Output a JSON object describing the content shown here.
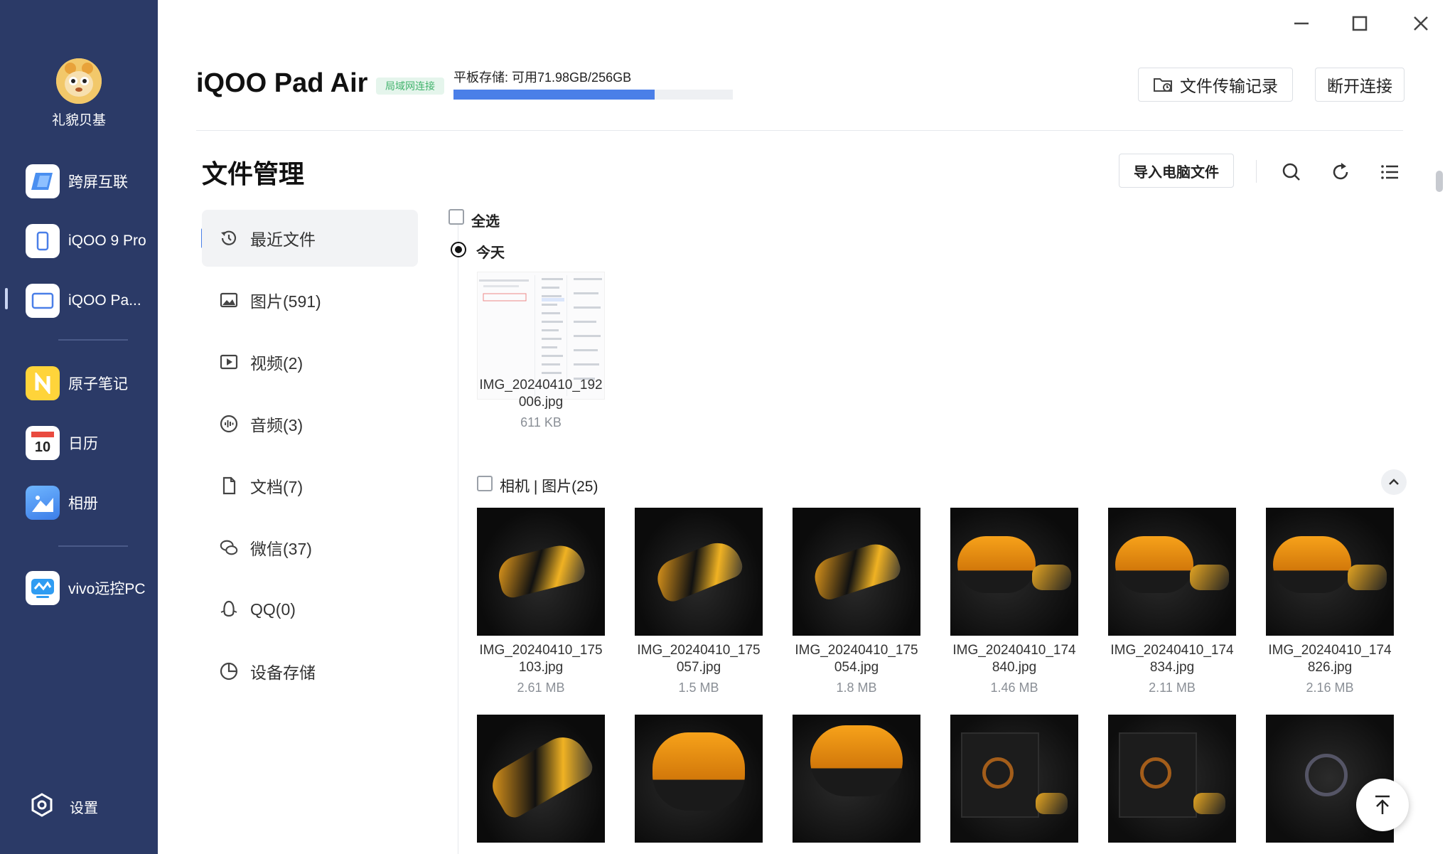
{
  "sidebar": {
    "user_name": "礼貌贝基",
    "items": [
      {
        "label": "跨屏互联"
      },
      {
        "label": "iQOO 9 Pro"
      },
      {
        "label": "iQOO Pa..."
      },
      {
        "label": "原子笔记"
      },
      {
        "label": "日历",
        "calendar_day": "10"
      },
      {
        "label": "相册"
      },
      {
        "label": "vivo远控PC"
      }
    ],
    "settings_label": "设置"
  },
  "window": {
    "minimize": "—",
    "maximize": "☐",
    "close": "✕"
  },
  "header": {
    "device_name": "iQOO Pad Air",
    "connection_tag": "局域网连接",
    "storage_text": "平板存储: 可用71.98GB/256GB",
    "storage_used_fraction": 0.72,
    "transfer_log_button": "文件传输记录",
    "disconnect_button": "断开连接"
  },
  "page": {
    "title": "文件管理",
    "import_button": "导入电脑文件"
  },
  "categories": [
    {
      "label": "最近文件",
      "icon": "history-icon"
    },
    {
      "label": "图片(591)",
      "icon": "image-icon"
    },
    {
      "label": "视频(2)",
      "icon": "video-icon"
    },
    {
      "label": "音频(3)",
      "icon": "audio-icon"
    },
    {
      "label": "文档(7)",
      "icon": "document-icon"
    },
    {
      "label": "微信(37)",
      "icon": "wechat-icon"
    },
    {
      "label": "QQ(0)",
      "icon": "qq-icon"
    },
    {
      "label": "设备存储",
      "icon": "storage-icon"
    }
  ],
  "files": {
    "select_all": "全选",
    "today_label": "今天",
    "today_files": [
      {
        "name": "IMG_20240410_192006.jpg",
        "name_l1": "IMG_20240410_192",
        "name_l2": "006.jpg",
        "size": "611 KB"
      }
    ],
    "group_label": "相机 | 图片(25)",
    "camera_files": [
      {
        "name_l1": "IMG_20240410_175",
        "name_l2": "103.jpg",
        "size": "2.61 MB"
      },
      {
        "name_l1": "IMG_20240410_175",
        "name_l2": "057.jpg",
        "size": "1.5 MB"
      },
      {
        "name_l1": "IMG_20240410_175",
        "name_l2": "054.jpg",
        "size": "1.8 MB"
      },
      {
        "name_l1": "IMG_20240410_174",
        "name_l2": "840.jpg",
        "size": "1.46 MB"
      },
      {
        "name_l1": "IMG_20240410_174",
        "name_l2": "834.jpg",
        "size": "2.11 MB"
      },
      {
        "name_l1": "IMG_20240410_174",
        "name_l2": "826.jpg",
        "size": "2.16 MB"
      }
    ]
  }
}
